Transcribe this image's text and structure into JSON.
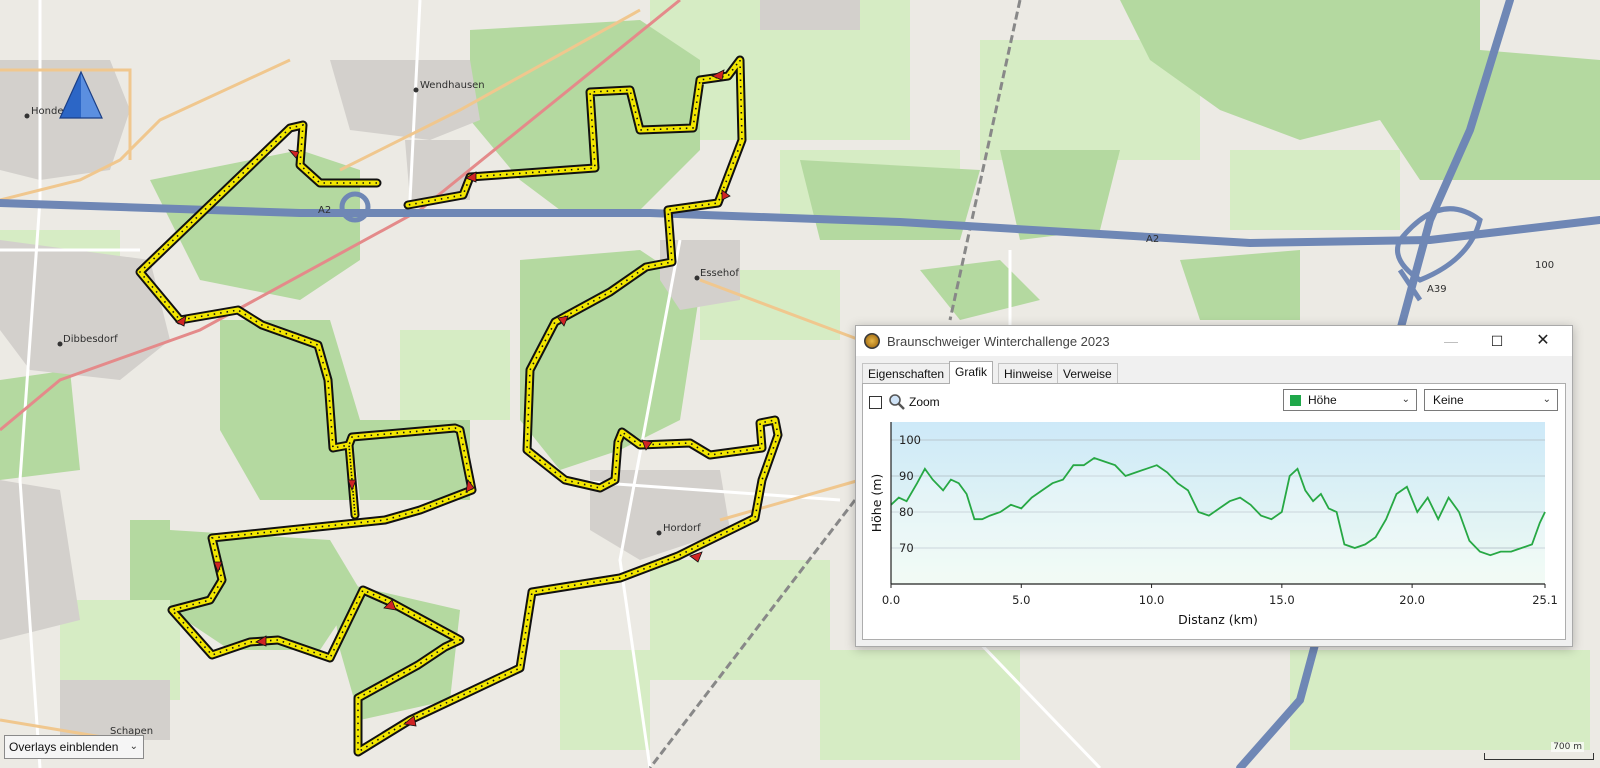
{
  "map": {
    "places": [
      {
        "name": "Hondelage"
      },
      {
        "name": "Wendhausen"
      },
      {
        "name": "Essehof"
      },
      {
        "name": "Dibbesdorf"
      },
      {
        "name": "Hordorf"
      },
      {
        "name": "Schapen"
      }
    ],
    "road_labels": [
      "A2",
      "A2",
      "A39",
      "100"
    ],
    "overlay_select": "Overlays einblenden",
    "scale": "700 m",
    "route_color": "#f2e600",
    "north_arrow_color": "#2c66c6"
  },
  "window": {
    "title": "Braunschweiger Winterchallenge 2023",
    "tabs": [
      "Eigenschaften",
      "Grafik",
      "Hinweise",
      "Verweise"
    ],
    "active_tab": "Grafik",
    "zoom_label": "Zoom",
    "zoom_checked": false,
    "height_select": "Höhe",
    "second_select": "Keine",
    "buttons": {
      "minimize": "—",
      "maximize": "☐",
      "close": "✕"
    }
  },
  "chart_data": {
    "type": "area",
    "title": "",
    "xlabel": "Distanz  (km)",
    "ylabel": "Höhe (m)",
    "xlim": [
      0,
      25.1
    ],
    "ylim": [
      60,
      105
    ],
    "xticks": [
      "0.0",
      "5.0",
      "10.0",
      "15.0",
      "20.0",
      "25.1"
    ],
    "yticks": [
      "70",
      "80",
      "90",
      "100"
    ],
    "grid": true,
    "line_color": "#27a844",
    "series": [
      {
        "x": [
          0,
          0.3,
          0.6,
          1.0,
          1.3,
          1.6,
          2.0,
          2.3,
          2.6,
          2.9,
          3.2,
          3.5,
          3.8,
          4.2,
          4.6,
          5.0,
          5.4,
          5.8,
          6.2,
          6.6,
          7.0,
          7.4,
          7.8,
          8.2,
          8.6,
          9.0,
          9.4,
          9.8,
          10.2,
          10.6,
          11.0,
          11.4,
          11.8,
          12.2,
          12.6,
          13.0,
          13.4,
          13.8,
          14.2,
          14.6,
          15.0,
          15.3,
          15.6,
          15.9,
          16.2,
          16.5,
          16.8,
          17.1,
          17.4,
          17.8,
          18.2,
          18.6,
          19.0,
          19.4,
          19.8,
          20.2,
          20.6,
          21.0,
          21.4,
          21.8,
          22.2,
          22.6,
          23.0,
          23.4,
          23.8,
          24.2,
          24.6,
          24.9,
          25.1
        ],
        "values": [
          82,
          84,
          83,
          88,
          92,
          89,
          86,
          89,
          88,
          85,
          78,
          78,
          79,
          80,
          82,
          81,
          84,
          86,
          88,
          89,
          93,
          93,
          95,
          94,
          93,
          90,
          91,
          92,
          93,
          91,
          88,
          86,
          80,
          79,
          81,
          83,
          84,
          82,
          79,
          78,
          80,
          90,
          92,
          86,
          83,
          85,
          81,
          80,
          71,
          70,
          71,
          73,
          78,
          85,
          87,
          80,
          84,
          78,
          84,
          80,
          72,
          69,
          68,
          69,
          69,
          70,
          71,
          77,
          80
        ]
      }
    ]
  }
}
